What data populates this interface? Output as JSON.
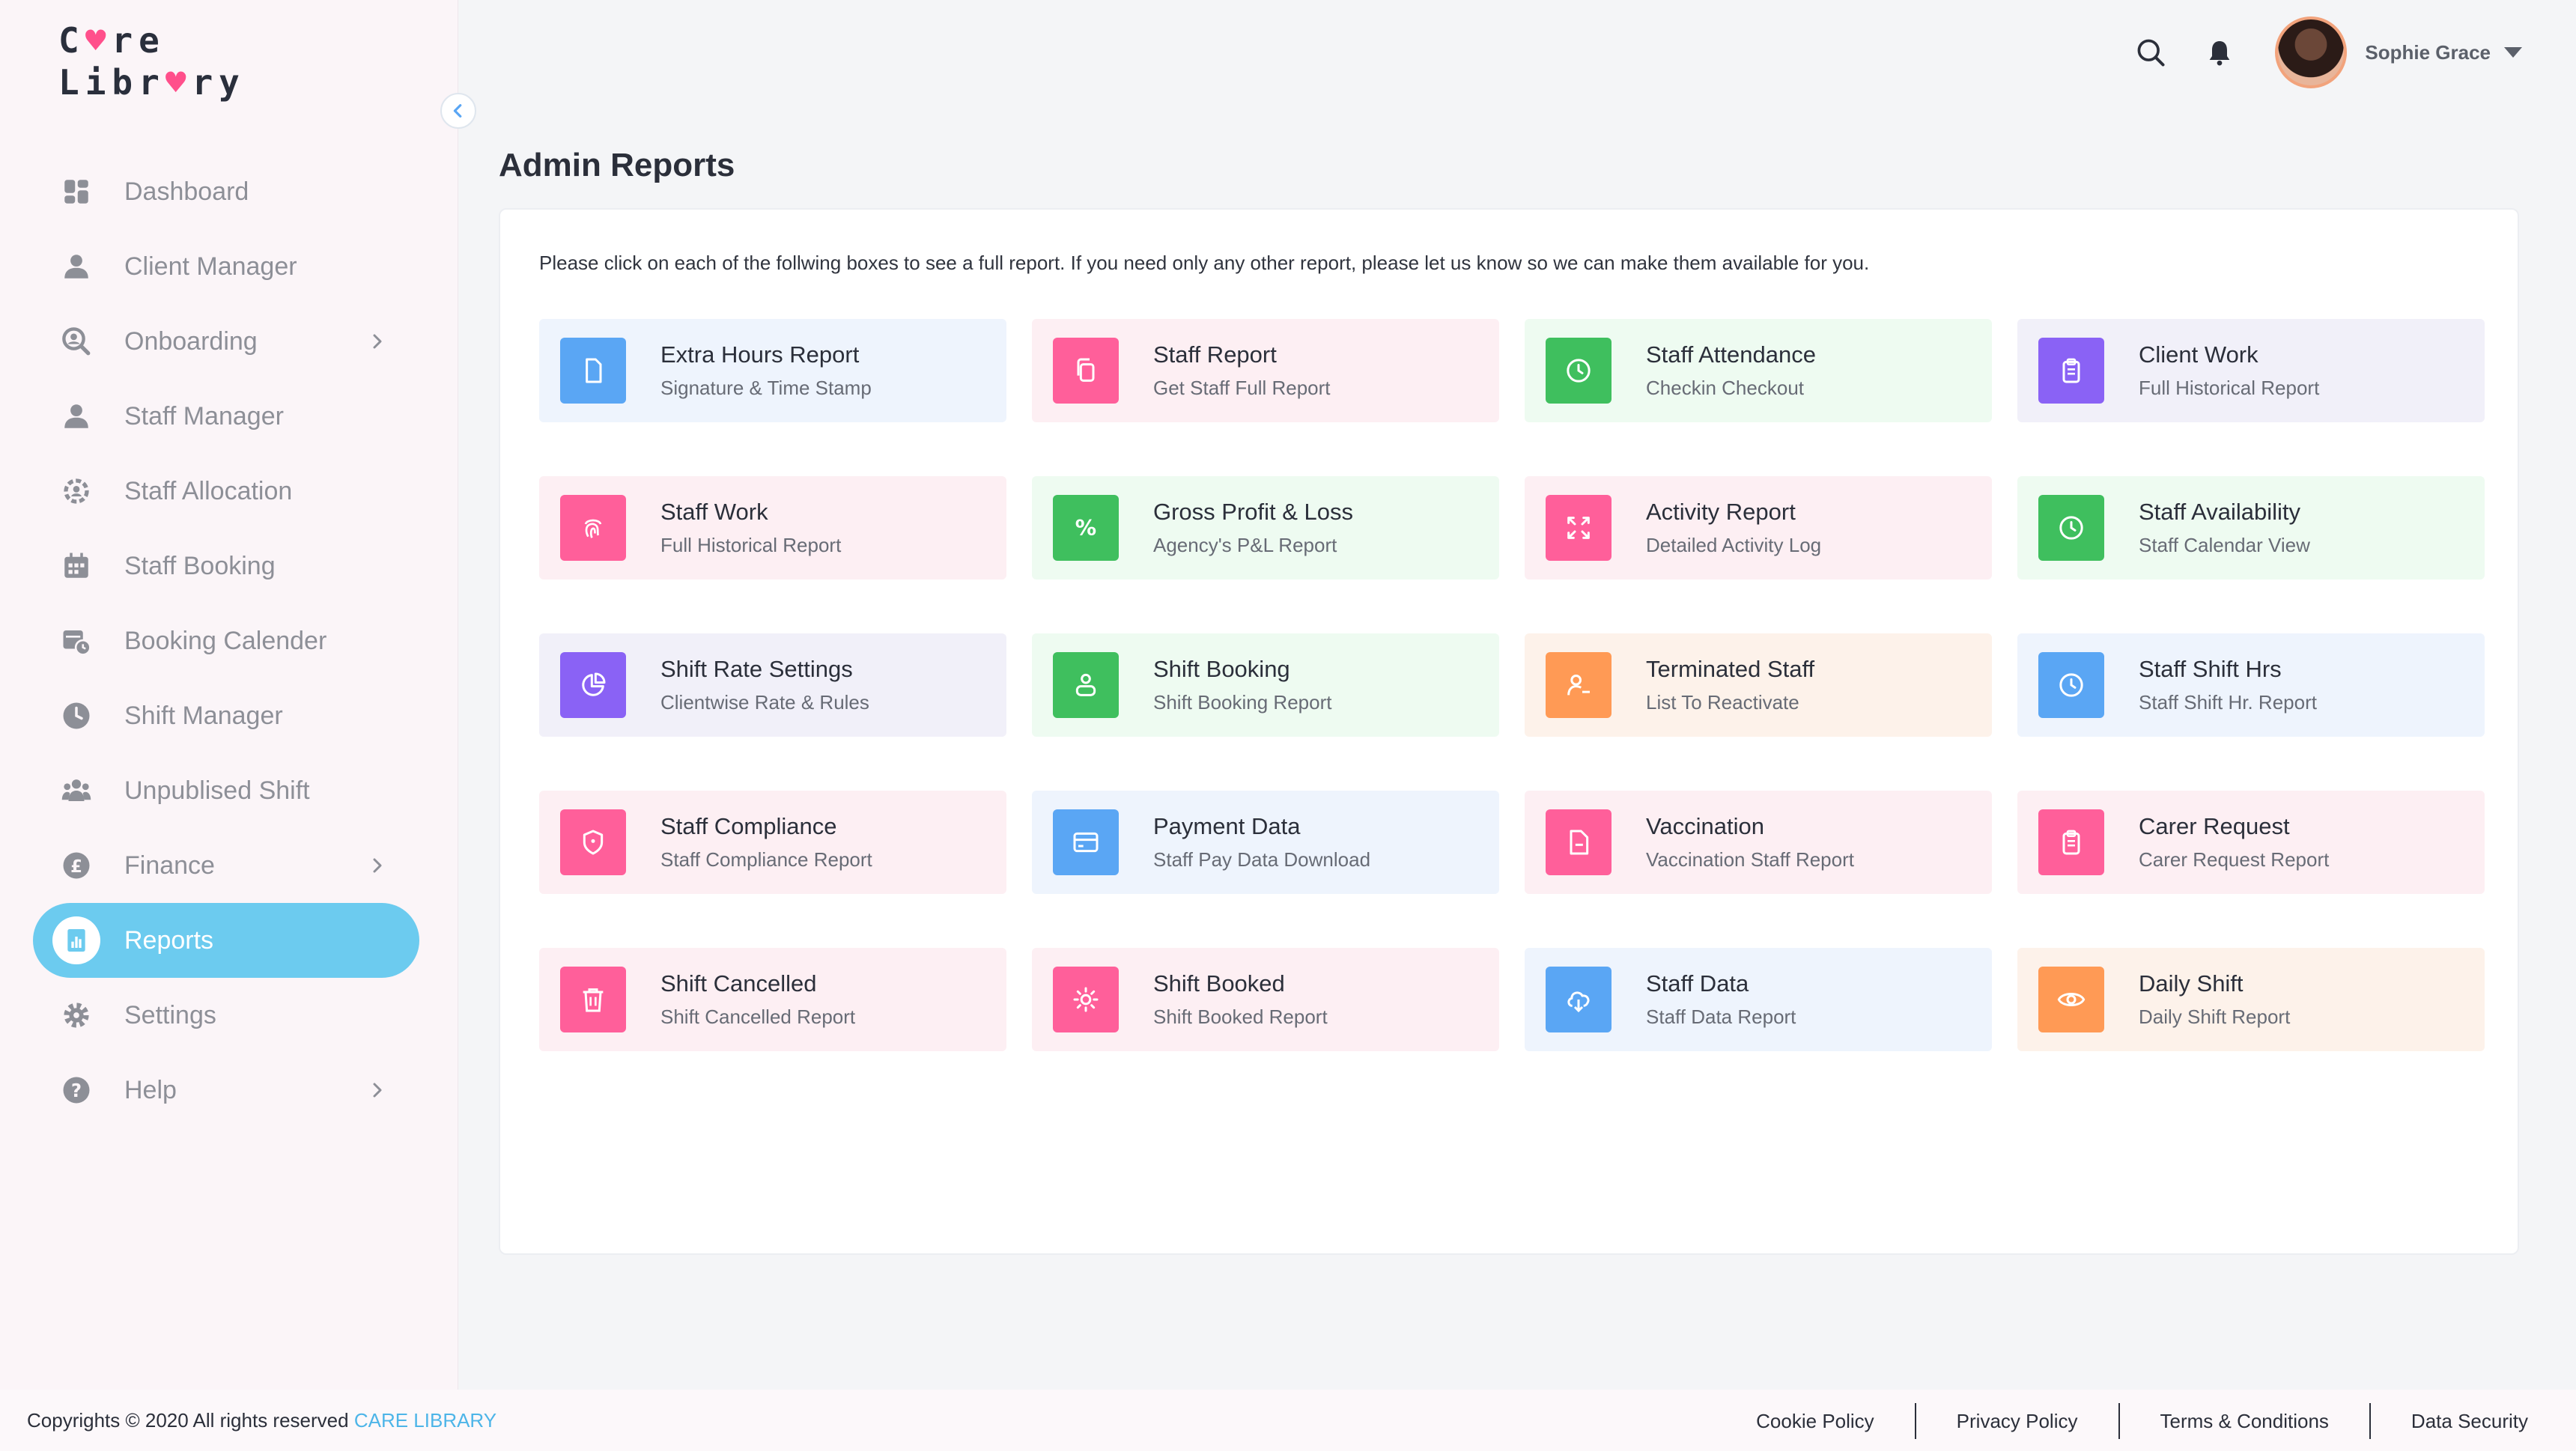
{
  "logo": {
    "line1_a": "C",
    "line1_b": "re",
    "line2_a": "Libr",
    "line2_b": "ry"
  },
  "sidebar": {
    "items": [
      {
        "label": "Dashboard",
        "icon": "dashboard-icon"
      },
      {
        "label": "Client Manager",
        "icon": "user-icon"
      },
      {
        "label": "Onboarding",
        "icon": "search-user-icon",
        "has_submenu": true
      },
      {
        "label": "Staff Manager",
        "icon": "user-icon"
      },
      {
        "label": "Staff Allocation",
        "icon": "settings-cog-icon"
      },
      {
        "label": "Staff Booking",
        "icon": "calendar-icon"
      },
      {
        "label": "Booking Calender",
        "icon": "calendar-clock-icon"
      },
      {
        "label": "Shift Manager",
        "icon": "clock-icon"
      },
      {
        "label": "Unpublised Shift",
        "icon": "group-icon"
      },
      {
        "label": "Finance",
        "icon": "pound-icon",
        "has_submenu": true
      },
      {
        "label": "Reports",
        "icon": "report-icon",
        "active": true
      },
      {
        "label": "Settings",
        "icon": "gear-icon"
      },
      {
        "label": "Help",
        "icon": "help-icon",
        "has_submenu": true
      }
    ]
  },
  "header": {
    "user_name": "Sophie Grace"
  },
  "main": {
    "title": "Admin Reports",
    "intro": "Please click on each of the follwing boxes to see a full report. If you need only any other report, please let us know so we can make them available for you.",
    "cards": [
      {
        "title": "Extra Hours Report",
        "subtitle": "Signature & Time Stamp",
        "icon": "document-icon",
        "color": "blue"
      },
      {
        "title": "Staff Report",
        "subtitle": "Get Staff Full Report",
        "icon": "copy-icon",
        "color": "pink"
      },
      {
        "title": "Staff Attendance",
        "subtitle": "Checkin Checkout",
        "icon": "clock-icon",
        "color": "green"
      },
      {
        "title": "Client Work",
        "subtitle": "Full Historical Report",
        "icon": "clipboard-icon",
        "color": "purple"
      },
      {
        "title": "Staff Work",
        "subtitle": "Full Historical Report",
        "icon": "fingerprint-icon",
        "color": "pink"
      },
      {
        "title": "Gross Profit & Loss",
        "subtitle": "Agency's P&L Report",
        "icon": "percent-icon",
        "color": "green"
      },
      {
        "title": "Activity Report",
        "subtitle": "Detailed Activity Log",
        "icon": "expand-icon",
        "color": "pink"
      },
      {
        "title": "Staff Availability",
        "subtitle": "Staff Calendar View",
        "icon": "clock-icon",
        "color": "green"
      },
      {
        "title": "Shift Rate Settings",
        "subtitle": "Clientwise Rate & Rules",
        "icon": "pie-chart-icon",
        "color": "purple"
      },
      {
        "title": "Shift Booking",
        "subtitle": "Shift Booking Report",
        "icon": "users-icon",
        "color": "green"
      },
      {
        "title": "Terminated Staff",
        "subtitle": "List To Reactivate",
        "icon": "user-remove-icon",
        "color": "orange"
      },
      {
        "title": "Staff Shift Hrs",
        "subtitle": "Staff Shift Hr. Report",
        "icon": "clock-icon",
        "color": "blue"
      },
      {
        "title": "Staff Compliance",
        "subtitle": "Staff Compliance Report",
        "icon": "shield-icon",
        "color": "pink"
      },
      {
        "title": "Payment Data",
        "subtitle": "Staff Pay Data Download",
        "icon": "credit-card-icon",
        "color": "blue"
      },
      {
        "title": "Vaccination",
        "subtitle": "Vaccination Staff Report",
        "icon": "file-minus-icon",
        "color": "pink"
      },
      {
        "title": "Carer Request",
        "subtitle": "Carer Request Report",
        "icon": "clipboard-icon",
        "color": "pink"
      },
      {
        "title": "Shift Cancelled",
        "subtitle": "Shift Cancelled Report",
        "icon": "trash-icon",
        "color": "pink"
      },
      {
        "title": "Shift Booked",
        "subtitle": "Shift Booked Report",
        "icon": "sun-icon",
        "color": "pink"
      },
      {
        "title": "Staff Data",
        "subtitle": "Staff Data Report",
        "icon": "cloud-download-icon",
        "color": "blue"
      },
      {
        "title": "Daily Shift",
        "subtitle": "Daily Shift Report",
        "icon": "eye-icon",
        "color": "orange"
      }
    ]
  },
  "footer": {
    "copyright": "Copyrights © 2020  All rights reserved",
    "brand": "CARE LIBRARY",
    "links": [
      "Cookie Policy",
      "Privacy Policy",
      "Terms & Conditions",
      "Data Security"
    ]
  },
  "colors": {
    "accent": "#6ccbef",
    "blue": "#5aa6f4",
    "pink": "#ff5f9a",
    "green": "#3fbf5e",
    "purple": "#8a62f5",
    "orange": "#ff9a55"
  }
}
